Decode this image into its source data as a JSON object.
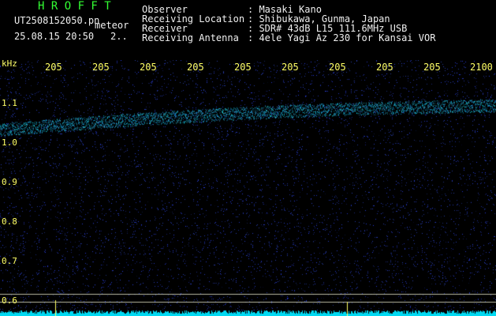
{
  "header": {
    "app_title": "H R O F F T",
    "filename": "UT2508152050.pn",
    "type": "meteor",
    "datetime": "25.08.15 20:50",
    "extra": "2..",
    "fields": [
      {
        "label": "Observer",
        "value": ": Masaki Kano"
      },
      {
        "label": "Receiving Location",
        "value": ": Shibukawa, Gunma, Japan"
      },
      {
        "label": "Receiver",
        "value": ": SDR# 43dB L15 111.6MHz USB"
      },
      {
        "label": "Receiving Antenna",
        "value": ": 4ele Yagi Az 230 for Kansai VOR"
      }
    ]
  },
  "axis": {
    "y_unit": "kHz",
    "y_ticks": [
      "1.1",
      "1.0",
      "0.9",
      "0.8",
      "0.7",
      "0.6"
    ],
    "x_ticks": [
      "205",
      "205",
      "205",
      "205",
      "205",
      "205",
      "205",
      "205",
      "205",
      "2100"
    ]
  },
  "colors": {
    "background": "#000000",
    "label_yellow": "#ffff66",
    "title_green": "#33ff33",
    "signal_cyan": "#00e5ff",
    "noise_blue": "#1a2a9a"
  }
}
